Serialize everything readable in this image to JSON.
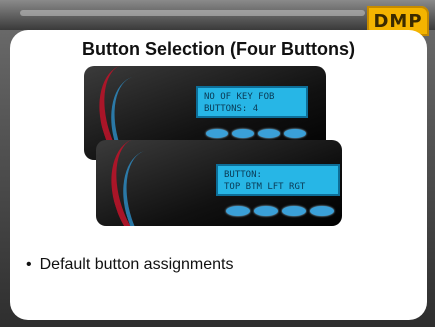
{
  "logo": {
    "text": "DMP"
  },
  "slide": {
    "title": "Button Selection (Four Buttons)"
  },
  "device1": {
    "lcd_line1": "NO OF KEY FOB",
    "lcd_line2": "BUTTONS: 4"
  },
  "device2": {
    "lcd_line1": "BUTTON:",
    "lcd_line2": "TOP BTM LFT RGT"
  },
  "bullets": [
    {
      "symbol": "•",
      "text": "Default button assignments"
    }
  ],
  "colors": {
    "lcd": "#27b6e6",
    "accent_red": "#b8142a",
    "logo": "#f4b400",
    "slide_bg": "#ffffff"
  }
}
